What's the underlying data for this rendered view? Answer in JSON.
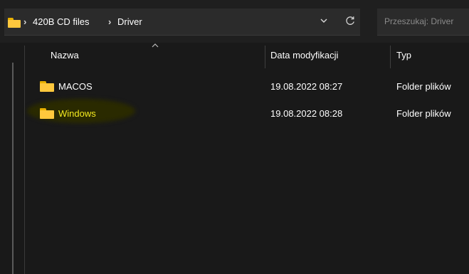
{
  "address": {
    "crumbs": [
      "420B CD files",
      "Driver"
    ],
    "separator": "›",
    "folder_icon": "folder-icon",
    "dropdown_icon": "chevron-down-icon",
    "refresh_icon": "refresh-icon"
  },
  "search": {
    "placeholder": "Przeszukaj: Driver"
  },
  "columns": {
    "name": "Nazwa",
    "date": "Data modyfikacji",
    "type": "Typ",
    "sort_icon": "chevron-up-icon"
  },
  "files": [
    {
      "name": "MACOS",
      "date": "19.08.2022 08:27",
      "type": "Folder plików",
      "icon": "folder-icon"
    },
    {
      "name": "Windows",
      "date": "19.08.2022 08:28",
      "type": "Folder plików",
      "icon": "folder-icon",
      "highlighted": true
    }
  ],
  "colors": {
    "background": "#191919",
    "folder": "#ffc83d",
    "highlight_text": "#f4ea1f"
  }
}
